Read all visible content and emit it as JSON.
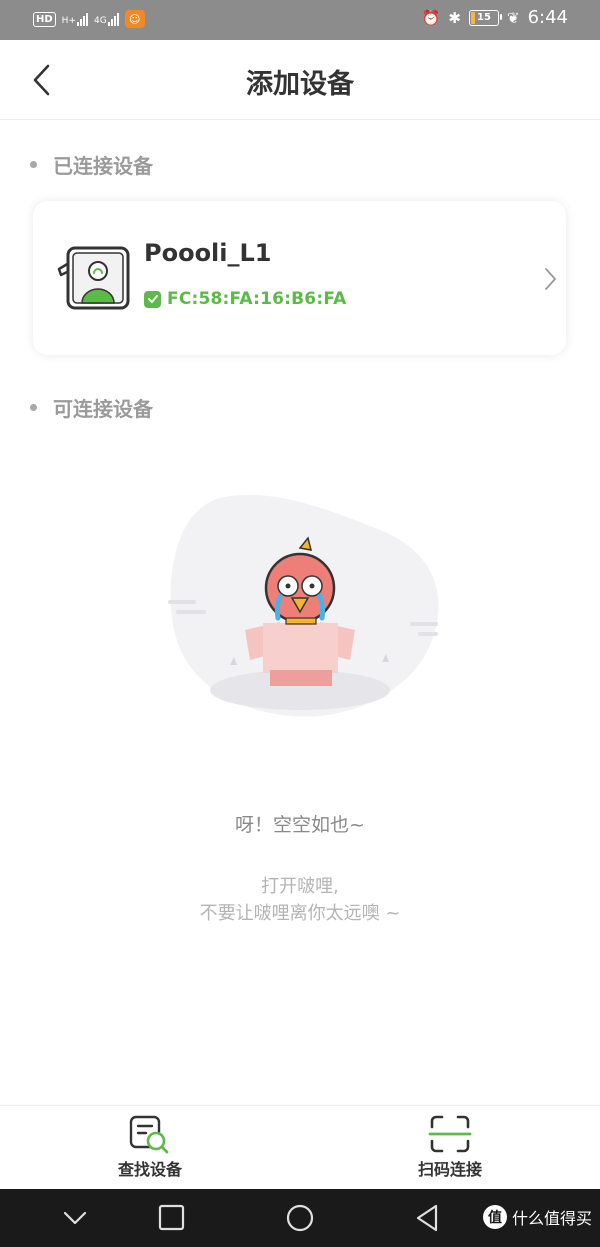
{
  "status_bar": {
    "left_badge": "HD",
    "signal_1_label": "H+",
    "signal_2_label": "4G",
    "battery_level": "15",
    "time": "6:44",
    "battery_fraction": 0.15
  },
  "header": {
    "title": "添加设备"
  },
  "connected_section": {
    "title": "已连接设备",
    "devices": [
      {
        "name": "Poooli_L1",
        "mac": "FC:58:FA:16:B6:FA"
      }
    ]
  },
  "available_section": {
    "title": "可连接设备"
  },
  "empty_state": {
    "message": "呀！空空如也~",
    "hint_line_1": "打开啵哩,",
    "hint_line_2": "不要让啵哩离你太远噢 ~"
  },
  "bottom_bar": {
    "find_device_label": "查找设备",
    "scan_connect_label": "扫码连接"
  },
  "watermark": {
    "logo_text": "值",
    "text": "什么值得买"
  },
  "colors": {
    "accent_green": "#5cbb46",
    "status_bar_bg": "#8c8c8c",
    "navbar_bg": "#1a1a1a"
  }
}
